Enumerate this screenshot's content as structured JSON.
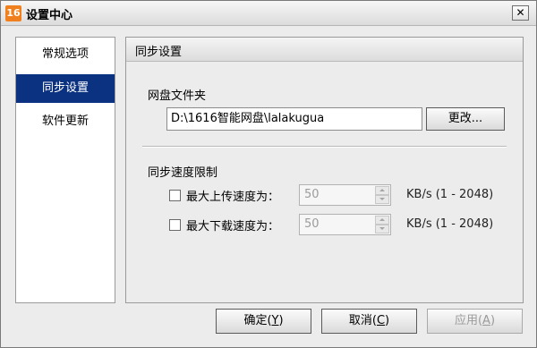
{
  "window": {
    "title": "设置中心",
    "app_icon_text": "16",
    "close_glyph": "✕"
  },
  "sidebar": {
    "items": [
      {
        "label": "常规选项",
        "active": false
      },
      {
        "label": "同步设置",
        "active": true
      },
      {
        "label": "软件更新",
        "active": false
      }
    ]
  },
  "panel": {
    "title": "同步设置",
    "folder_section": {
      "label": "网盘文件夹",
      "path_value": "D:\\1616智能网盘\\lalakugua",
      "change_button": "更改..."
    },
    "speed_section": {
      "label": "同步速度限制",
      "upload": {
        "label": "最大上传速度为：",
        "value": "50",
        "units": "KB/s (1 - 2048)",
        "checked": false
      },
      "download": {
        "label": "最大下载速度为：",
        "value": "50",
        "units": "KB/s (1 - 2048)",
        "checked": false
      }
    }
  },
  "footer": {
    "ok": {
      "text": "确定(",
      "key": "Y",
      "tail": ")"
    },
    "cancel": {
      "text": "取消(",
      "key": "C",
      "tail": ")"
    },
    "apply": {
      "text": "应用(",
      "key": "A",
      "tail": ")",
      "disabled": true
    }
  }
}
